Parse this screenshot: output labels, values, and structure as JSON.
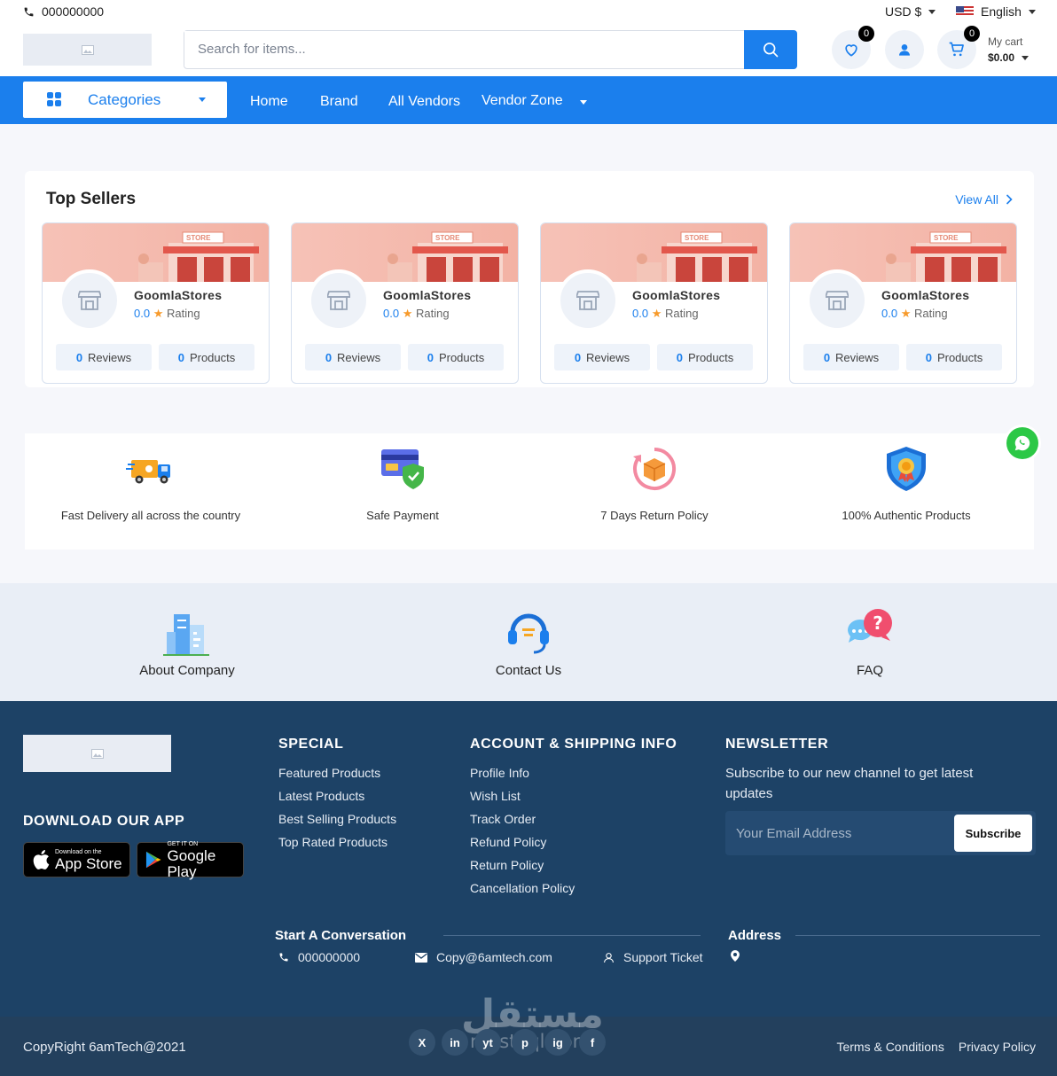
{
  "topbar": {
    "phone": "000000000",
    "currency": "USD $",
    "language": "English"
  },
  "header": {
    "search_placeholder": "Search for items...",
    "wishlist_count": "0",
    "cart_count": "0",
    "cart_label": "My cart",
    "cart_total": "$0.00"
  },
  "nav": {
    "categories": "Categories",
    "links": [
      "Home",
      "Brand",
      "All Vendors",
      "Vendor Zone"
    ]
  },
  "top_sellers": {
    "title": "Top Sellers",
    "view_all": "View All",
    "sellers": [
      {
        "name": "GoomlaStores",
        "rating": "0.0",
        "rating_label": "Rating",
        "reviews": "0",
        "reviews_label": "Reviews",
        "products": "0",
        "products_label": "Products",
        "banner_text": "STORE"
      },
      {
        "name": "GoomlaStores",
        "rating": "0.0",
        "rating_label": "Rating",
        "reviews": "0",
        "reviews_label": "Reviews",
        "products": "0",
        "products_label": "Products",
        "banner_text": "STORE"
      },
      {
        "name": "GoomlaStores",
        "rating": "0.0",
        "rating_label": "Rating",
        "reviews": "0",
        "reviews_label": "Reviews",
        "products": "0",
        "products_label": "Products",
        "banner_text": "STORE"
      },
      {
        "name": "GoomlaStores",
        "rating": "0.0",
        "rating_label": "Rating",
        "reviews": "0",
        "reviews_label": "Reviews",
        "products": "0",
        "products_label": "Products",
        "banner_text": "STORE"
      }
    ]
  },
  "features": [
    {
      "text": "Fast Delivery all across the country",
      "icon": "delivery-truck-icon"
    },
    {
      "text": "Safe Payment",
      "icon": "safe-payment-icon"
    },
    {
      "text": "7 Days Return Policy",
      "icon": "return-box-icon"
    },
    {
      "text": "100% Authentic Products",
      "icon": "authentic-badge-icon"
    }
  ],
  "info_links": [
    {
      "text": "About Company",
      "icon": "building-icon"
    },
    {
      "text": "Contact Us",
      "icon": "headset-icon"
    },
    {
      "text": "FAQ",
      "icon": "faq-bubbles-icon"
    }
  ],
  "footer": {
    "download_title": "DOWNLOAD OUR APP",
    "app_store": {
      "small": "Download on the",
      "large": "App Store"
    },
    "google_play": {
      "small": "GET IT ON",
      "large": "Google Play"
    },
    "special_title": "SPECIAL",
    "special_links": [
      "Featured Products",
      "Latest Products",
      "Best Selling Products",
      "Top Rated Products"
    ],
    "account_title": "ACCOUNT & SHIPPING INFO",
    "account_links": [
      "Profile Info",
      "Wish List",
      "Track Order",
      "Refund Policy",
      "Return Policy",
      "Cancellation Policy"
    ],
    "newsletter_title": "NEWSLETTER",
    "newsletter_text": "Subscribe to our new channel to get latest updates",
    "email_placeholder": "Your Email Address",
    "subscribe": "Subscribe",
    "conversation_title": "Start A Conversation",
    "phone": "000000000",
    "email": "Copy@6amtech.com",
    "support": "Support Ticket",
    "address_title": "Address"
  },
  "bottom": {
    "copyright": "CopyRight 6amTech@2021",
    "social": [
      "X",
      "in",
      "yt",
      "p",
      "ig",
      "f"
    ],
    "terms": "Terms & Conditions",
    "privacy": "Privacy Policy",
    "watermark": "مستقل",
    "watermark_url": "mostaql.com"
  },
  "colors": {
    "primary": "#1b7fed",
    "footer": "#1d4266",
    "bottom": "#23405d"
  }
}
